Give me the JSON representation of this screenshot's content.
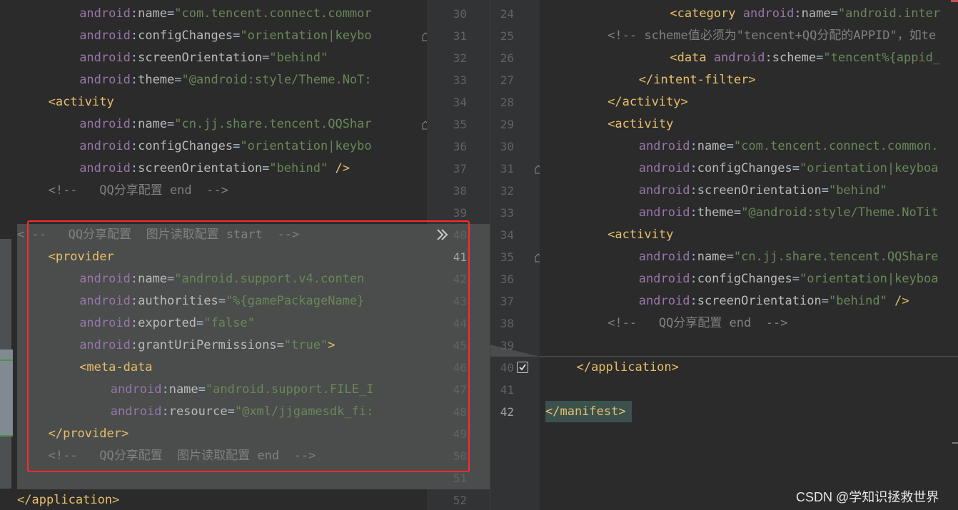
{
  "left_pane": {
    "lines": [
      {
        "indent": 4,
        "tokens": [
          [
            "ns",
            "android"
          ],
          [
            "plain",
            ":"
          ],
          [
            "attr",
            "name"
          ],
          [
            "plain",
            "="
          ],
          [
            "val",
            "\"com.tencent.connect.commor"
          ]
        ]
      },
      {
        "indent": 4,
        "tokens": [
          [
            "ns",
            "android"
          ],
          [
            "plain",
            ":"
          ],
          [
            "attr",
            "configChanges"
          ],
          [
            "plain",
            "="
          ],
          [
            "val",
            "\"orientation|keybo"
          ]
        ]
      },
      {
        "indent": 4,
        "tokens": [
          [
            "ns",
            "android"
          ],
          [
            "plain",
            ":"
          ],
          [
            "attr",
            "screenOrientation"
          ],
          [
            "plain",
            "="
          ],
          [
            "val",
            "\"behind\""
          ]
        ]
      },
      {
        "indent": 4,
        "tokens": [
          [
            "ns",
            "android"
          ],
          [
            "plain",
            ":"
          ],
          [
            "attr",
            "theme"
          ],
          [
            "plain",
            "="
          ],
          [
            "val",
            "\"@android:style/Theme.NoT:"
          ]
        ]
      },
      {
        "indent": 2,
        "tokens": [
          [
            "tag",
            "<activity"
          ]
        ]
      },
      {
        "indent": 4,
        "tokens": [
          [
            "ns",
            "android"
          ],
          [
            "plain",
            ":"
          ],
          [
            "attr",
            "name"
          ],
          [
            "plain",
            "="
          ],
          [
            "val",
            "\"cn.jj.share.tencent.QQShar"
          ]
        ]
      },
      {
        "indent": 4,
        "tokens": [
          [
            "ns",
            "android"
          ],
          [
            "plain",
            ":"
          ],
          [
            "attr",
            "configChanges"
          ],
          [
            "plain",
            "="
          ],
          [
            "val",
            "\"orientation|keybo"
          ]
        ]
      },
      {
        "indent": 4,
        "tokens": [
          [
            "ns",
            "android"
          ],
          [
            "plain",
            ":"
          ],
          [
            "attr",
            "screenOrientation"
          ],
          [
            "plain",
            "="
          ],
          [
            "val",
            "\"behind\""
          ],
          [
            "tag",
            " />"
          ]
        ]
      },
      {
        "indent": 2,
        "tokens": [
          [
            "com",
            "<!--   QQ分享配置 end  -->"
          ]
        ]
      },
      {
        "indent": 0,
        "tokens": []
      },
      {
        "indent": 0,
        "tokens": [
          [
            "com",
            "<!--   QQ分享配置  图片读取配置 start  -->"
          ]
        ]
      },
      {
        "indent": 2,
        "tokens": [
          [
            "tag",
            "<provider"
          ]
        ]
      },
      {
        "indent": 4,
        "tokens": [
          [
            "ns",
            "android"
          ],
          [
            "plain",
            ":"
          ],
          [
            "attr",
            "name"
          ],
          [
            "plain",
            "="
          ],
          [
            "val",
            "\"android.support.v4.conten"
          ]
        ]
      },
      {
        "indent": 4,
        "tokens": [
          [
            "ns",
            "android"
          ],
          [
            "plain",
            ":"
          ],
          [
            "attr",
            "authorities"
          ],
          [
            "plain",
            "="
          ],
          [
            "val",
            "\"%{gamePackageName}"
          ]
        ]
      },
      {
        "indent": 4,
        "tokens": [
          [
            "ns",
            "android"
          ],
          [
            "plain",
            ":"
          ],
          [
            "attr",
            "exported"
          ],
          [
            "plain",
            "="
          ],
          [
            "val",
            "\"false\""
          ]
        ]
      },
      {
        "indent": 4,
        "tokens": [
          [
            "ns",
            "android"
          ],
          [
            "plain",
            ":"
          ],
          [
            "attr",
            "grantUriPermissions"
          ],
          [
            "plain",
            "="
          ],
          [
            "val",
            "\"true\""
          ],
          [
            "tag",
            ">"
          ]
        ]
      },
      {
        "indent": 4,
        "tokens": [
          [
            "tag",
            "<meta-data"
          ]
        ]
      },
      {
        "indent": 6,
        "tokens": [
          [
            "ns",
            "android"
          ],
          [
            "plain",
            ":"
          ],
          [
            "attr",
            "name"
          ],
          [
            "plain",
            "="
          ],
          [
            "val",
            "\"android.support.FILE_I"
          ]
        ]
      },
      {
        "indent": 6,
        "tokens": [
          [
            "ns",
            "android"
          ],
          [
            "plain",
            ":"
          ],
          [
            "attr",
            "resource"
          ],
          [
            "plain",
            "="
          ],
          [
            "val",
            "\"@xml/jjgamesdk_fi:"
          ]
        ]
      },
      {
        "indent": 2,
        "tokens": [
          [
            "tag",
            "</provider>"
          ]
        ]
      },
      {
        "indent": 2,
        "tokens": [
          [
            "com",
            "<!--   QQ分享配置  图片读取配置 end  -->"
          ]
        ]
      },
      {
        "indent": 0,
        "tokens": []
      },
      {
        "indent": 0,
        "tokens": [
          [
            "tag",
            "</application>"
          ]
        ]
      }
    ],
    "line_numbers": [
      "30",
      "31",
      "32",
      "33",
      "34",
      "35",
      "36",
      "37",
      "38",
      "39",
      "40",
      "41",
      "42",
      "43",
      "44",
      "45",
      "46",
      "47",
      "48",
      "49",
      "50",
      "51",
      "52"
    ]
  },
  "right_pane": {
    "line_numbers": [
      "24",
      "25",
      "26",
      "27",
      "28",
      "29",
      "30",
      "31",
      "32",
      "33",
      "34",
      "35",
      "36",
      "37",
      "38",
      "39",
      "40",
      "41",
      "42"
    ],
    "lines": [
      {
        "indent": 8,
        "tokens": [
          [
            "tag",
            "<category "
          ],
          [
            "ns",
            "android"
          ],
          [
            "plain",
            ":"
          ],
          [
            "attr",
            "name"
          ],
          [
            "plain",
            "="
          ],
          [
            "val",
            "\"android.inter"
          ]
        ]
      },
      {
        "indent": 4,
        "tokens": [
          [
            "com",
            "<!-- scheme值必须为\"tencent+QQ分配的APPID\"，如te"
          ]
        ]
      },
      {
        "indent": 8,
        "tokens": [
          [
            "tag",
            "<data "
          ],
          [
            "ns",
            "android"
          ],
          [
            "plain",
            ":"
          ],
          [
            "attr",
            "scheme"
          ],
          [
            "plain",
            "="
          ],
          [
            "val",
            "\"tencent%{appid_"
          ]
        ]
      },
      {
        "indent": 6,
        "tokens": [
          [
            "tag",
            "</intent-filter>"
          ]
        ]
      },
      {
        "indent": 4,
        "tokens": [
          [
            "tag",
            "</activity>"
          ]
        ]
      },
      {
        "indent": 4,
        "tokens": [
          [
            "tag",
            "<activity"
          ]
        ]
      },
      {
        "indent": 6,
        "tokens": [
          [
            "ns",
            "android"
          ],
          [
            "plain",
            ":"
          ],
          [
            "attr",
            "name"
          ],
          [
            "plain",
            "="
          ],
          [
            "val",
            "\"com.tencent.connect.common."
          ]
        ]
      },
      {
        "indent": 6,
        "tokens": [
          [
            "ns",
            "android"
          ],
          [
            "plain",
            ":"
          ],
          [
            "attr",
            "configChanges"
          ],
          [
            "plain",
            "="
          ],
          [
            "val",
            "\"orientation|keyboa"
          ]
        ]
      },
      {
        "indent": 6,
        "tokens": [
          [
            "ns",
            "android"
          ],
          [
            "plain",
            ":"
          ],
          [
            "attr",
            "screenOrientation"
          ],
          [
            "plain",
            "="
          ],
          [
            "val",
            "\"behind\""
          ]
        ]
      },
      {
        "indent": 6,
        "tokens": [
          [
            "ns",
            "android"
          ],
          [
            "plain",
            ":"
          ],
          [
            "attr",
            "theme"
          ],
          [
            "plain",
            "="
          ],
          [
            "val",
            "\"@android:style/Theme.NoTit"
          ]
        ]
      },
      {
        "indent": 4,
        "tokens": [
          [
            "tag",
            "<activity"
          ]
        ]
      },
      {
        "indent": 6,
        "tokens": [
          [
            "ns",
            "android"
          ],
          [
            "plain",
            ":"
          ],
          [
            "attr",
            "name"
          ],
          [
            "plain",
            "="
          ],
          [
            "val",
            "\"cn.jj.share.tencent.QQShare"
          ]
        ]
      },
      {
        "indent": 6,
        "tokens": [
          [
            "ns",
            "android"
          ],
          [
            "plain",
            ":"
          ],
          [
            "attr",
            "configChanges"
          ],
          [
            "plain",
            "="
          ],
          [
            "val",
            "\"orientation|keyboa"
          ]
        ]
      },
      {
        "indent": 6,
        "tokens": [
          [
            "ns",
            "android"
          ],
          [
            "plain",
            ":"
          ],
          [
            "attr",
            "screenOrientation"
          ],
          [
            "plain",
            "="
          ],
          [
            "val",
            "\"behind\""
          ],
          [
            "tag",
            " />"
          ]
        ]
      },
      {
        "indent": 4,
        "tokens": [
          [
            "com",
            "<!--   QQ分享配置 end  -->"
          ]
        ]
      },
      {
        "indent": 0,
        "tokens": []
      },
      {
        "indent": 2,
        "tokens": [
          [
            "tag",
            "</application>"
          ]
        ]
      },
      {
        "indent": 0,
        "tokens": []
      },
      {
        "indent": 0,
        "tokens": [
          [
            "tag",
            "</manifest>"
          ]
        ]
      }
    ]
  },
  "watermark": "CSDN @学知识拯救世界",
  "colors": {
    "background": "#2b2b2b",
    "diff_block": "#4a4d4b",
    "red_highlight": "#ff2a2a",
    "tag": "#e8bf6a",
    "namespace": "#9876aa",
    "attribute": "#bababa",
    "value": "#6a8759",
    "comment": "#808080"
  }
}
